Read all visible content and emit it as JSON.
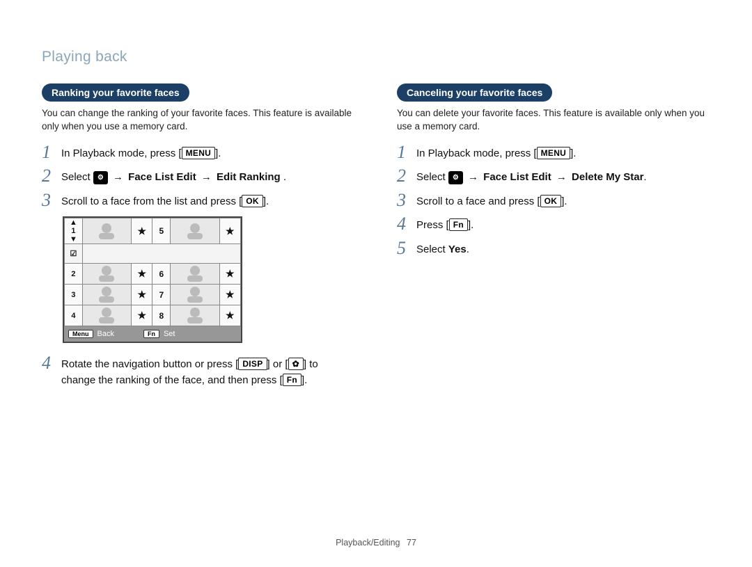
{
  "section_title": "Playing back",
  "left": {
    "pill": "Ranking your favorite faces",
    "intro": "You can change the ranking of your favorite faces. This feature is available only when you use a memory card.",
    "steps": {
      "s1": {
        "num": "1",
        "pre": "In Playback mode, press [",
        "btn": "MENU",
        "post": "]."
      },
      "s2": {
        "num": "2",
        "pre": "Select ",
        "arrow1": " → ",
        "bold1": "Face List Edit",
        "arrow2": " → ",
        "bold2": "Edit Ranking",
        "post": " ."
      },
      "s3": {
        "num": "3",
        "pre": "Scroll to a face from the list and press [",
        "btn": "OK",
        "post": "]."
      },
      "s4": {
        "num": "4",
        "pre": "Rotate the navigation button or press [",
        "btn1": "DISP",
        "mid": "] or [",
        "btn2_icon": "✿",
        "mid2": "] to change the ranking of the face, and then press [",
        "btn3": "Fn",
        "post": "]."
      }
    },
    "screen": {
      "rows_left": [
        "1",
        "2",
        "3",
        "4"
      ],
      "rows_right": [
        "5",
        "6",
        "7",
        "8"
      ],
      "star": "★",
      "check": "☑",
      "updown_up": "▲",
      "updown_dn": "▼",
      "bottom": {
        "menu": "Menu",
        "back": "Back",
        "fn": "Fn",
        "set": "Set"
      }
    }
  },
  "right": {
    "pill": "Canceling your favorite faces",
    "intro": "You can delete your favorite faces. This feature is available only when you use a memory card.",
    "steps": {
      "s1": {
        "num": "1",
        "pre": "In Playback mode, press [",
        "btn": "MENU",
        "post": "]."
      },
      "s2": {
        "num": "2",
        "pre": "Select ",
        "arrow1": " → ",
        "bold1": "Face List Edit",
        "arrow2": " → ",
        "bold2": "Delete My Star",
        "post": "."
      },
      "s3": {
        "num": "3",
        "pre": "Scroll to a face and press [",
        "btn": "OK",
        "post": "]."
      },
      "s4": {
        "num": "4",
        "pre": "Press [",
        "btn": "Fn",
        "post": "]."
      },
      "s5": {
        "num": "5",
        "pre": "Select ",
        "bold": "Yes",
        "post": "."
      }
    }
  },
  "footer": {
    "text": "Playback/Editing",
    "page": "77"
  }
}
